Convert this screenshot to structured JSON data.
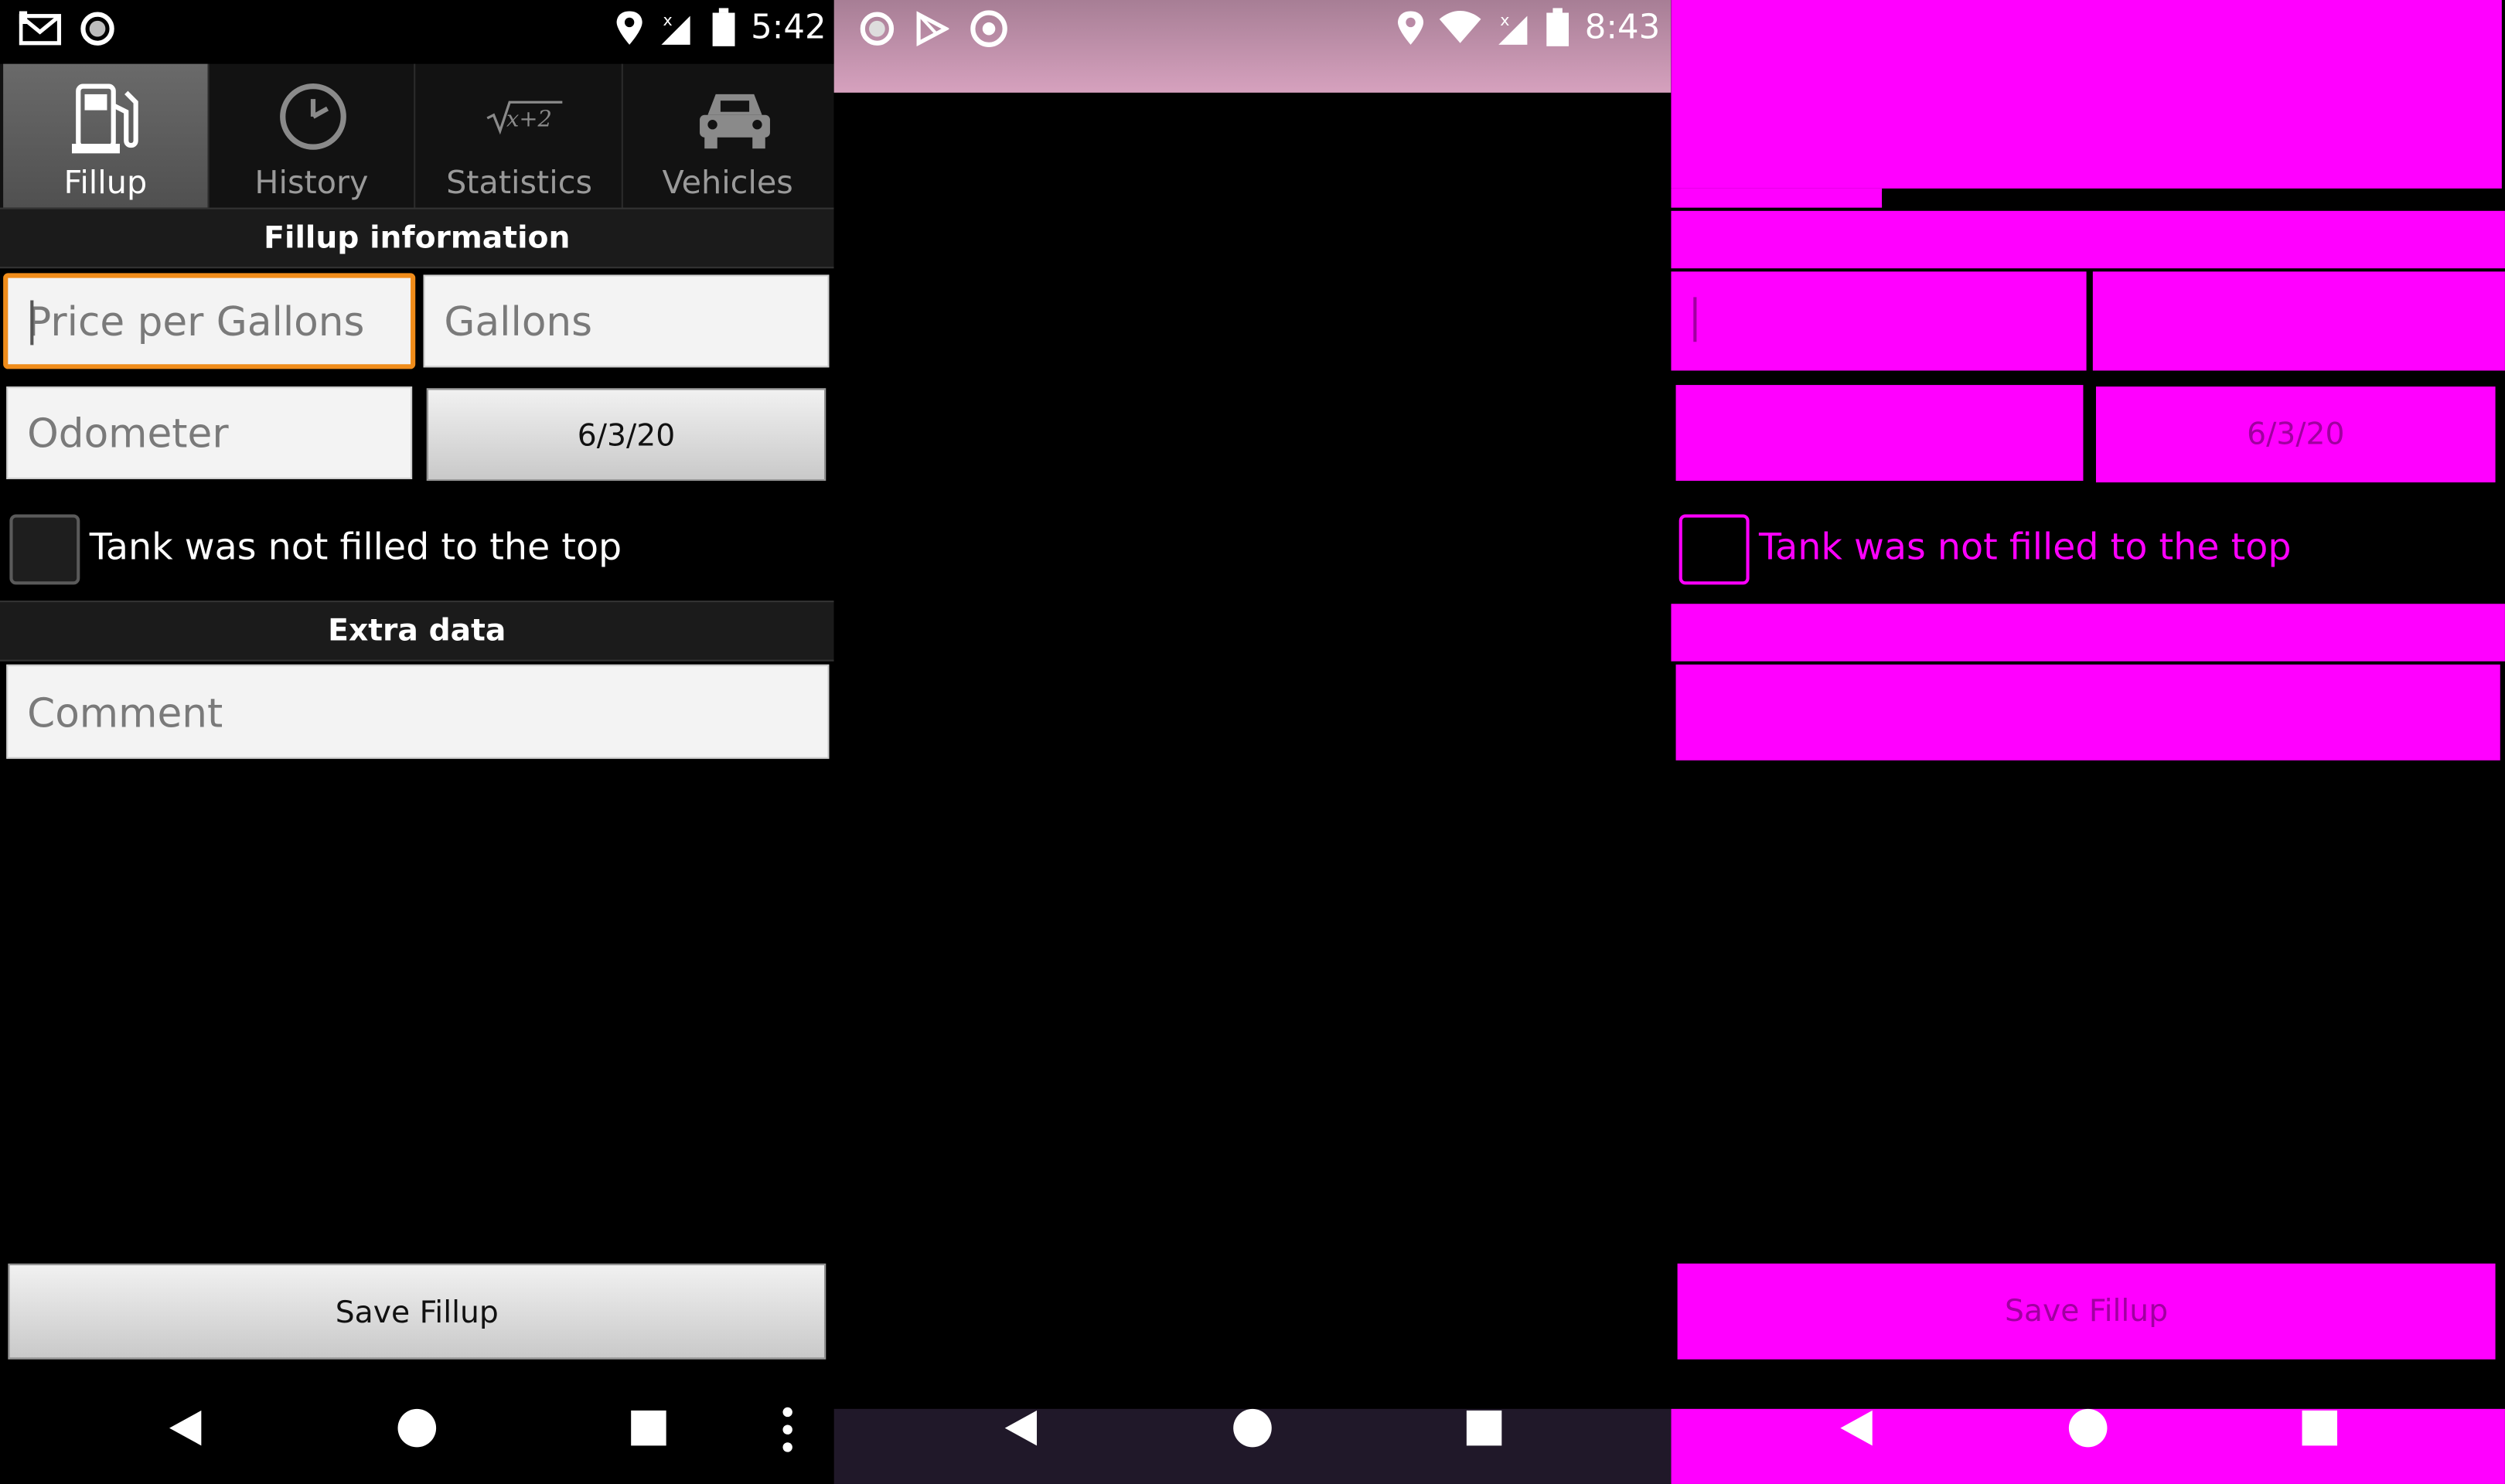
{
  "left": {
    "status_bar": {
      "time": "5:42",
      "icons": [
        "gmail-icon",
        "circle-notification-icon",
        "location-icon",
        "signal-icon",
        "battery-icon"
      ]
    },
    "tabs": [
      {
        "label": "Fillup",
        "icon": "fuel-pump-icon",
        "active": true
      },
      {
        "label": "History",
        "icon": "clock-icon",
        "active": false
      },
      {
        "label": "Statistics",
        "icon": "sqrt-formula-icon",
        "active": false
      },
      {
        "label": "Vehicles",
        "icon": "car-icon",
        "active": false
      }
    ],
    "section_fillup": "Fillup information",
    "price_placeholder": "Price per Gallons",
    "gallons_placeholder": "Gallons",
    "odometer_placeholder": "Odometer",
    "date_value": "6/3/20",
    "tank_checkbox_label": "Tank was not filled to the top",
    "section_extra": "Extra data",
    "comment_placeholder": "Comment",
    "save_button": "Save Fillup"
  },
  "middle": {
    "status_bar": {
      "time": "8:43",
      "icons": [
        "circle-notification-icon",
        "play-store-icon",
        "chrome-icon",
        "location-icon",
        "wifi-icon",
        "signal-icon",
        "battery-icon"
      ]
    },
    "status_bar_color": "#c48aa9",
    "nav_bar_color": "#201829"
  },
  "right": {
    "mask_color": "#ff00ff",
    "mask_text_color": "#a000a0",
    "date_value": "6/3/20",
    "tank_checkbox_label": "Tank was not filled to the top",
    "save_button": "Save Fillup"
  }
}
